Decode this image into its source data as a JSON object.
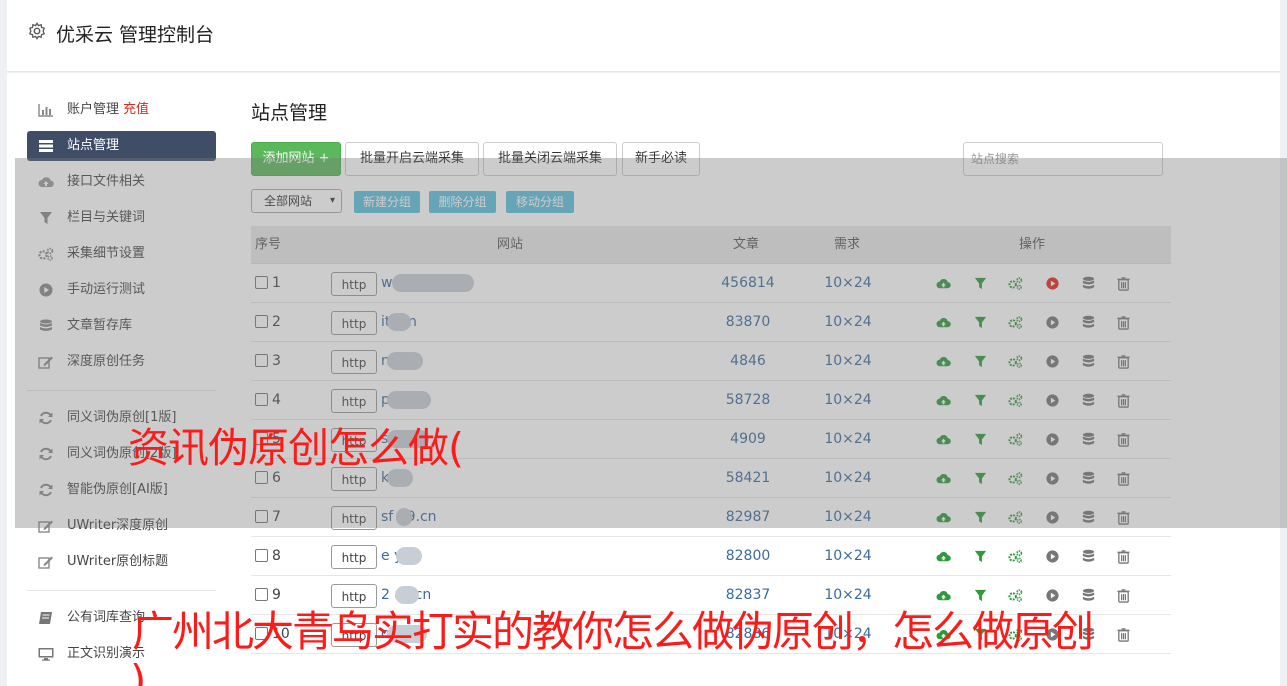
{
  "header": {
    "title": "优采云 管理控制台",
    "icon": "gear-icon"
  },
  "sidebar": {
    "items": [
      {
        "label": "账户管理",
        "extra": "充值",
        "icon": "bar-chart-icon"
      },
      {
        "label": "站点管理",
        "icon": "server-icon",
        "active": true
      },
      {
        "label": "接口文件相关",
        "icon": "cloud-upload-icon"
      },
      {
        "label": "栏目与关键词",
        "icon": "filter-icon"
      },
      {
        "label": "采集细节设置",
        "icon": "gears-icon"
      },
      {
        "label": "手动运行测试",
        "icon": "play-circle-icon"
      },
      {
        "label": "文章暂存库",
        "icon": "database-icon"
      },
      {
        "label": "深度原创任务",
        "icon": "edit-icon"
      },
      {
        "label": "同义词伪原创[1版]",
        "icon": "refresh-icon"
      },
      {
        "label": "同义词伪原创[2版]",
        "icon": "refresh-icon"
      },
      {
        "label": "智能伪原创[AI版]",
        "icon": "refresh-icon"
      },
      {
        "label": "UWriter深度原创",
        "icon": "edit-icon"
      },
      {
        "label": "UWriter原创标题",
        "icon": "edit-icon"
      },
      {
        "label": "公有词库查询",
        "icon": "book-icon"
      },
      {
        "label": "正文识别演示",
        "icon": "desktop-icon"
      }
    ]
  },
  "main": {
    "title": "站点管理",
    "buttons": {
      "add_site": "添加网站 +",
      "batch_open": "批量开启云端采集",
      "batch_close": "批量关闭云端采集",
      "newbie": "新手必读"
    },
    "search_placeholder": "站点搜索",
    "filter": {
      "selected": "全部网站",
      "new_group": "新建分组",
      "delete_group": "删除分组",
      "move_group": "移动分组"
    },
    "table": {
      "headers": {
        "index": "序号",
        "site": "网站",
        "articles": "文章",
        "demand": "需求",
        "actions": "操作"
      },
      "rows": [
        {
          "index": "1",
          "protocol": "http",
          "site": "w          .com",
          "articles": "456814",
          "demand": "10×24"
        },
        {
          "index": "2",
          "protocol": "http",
          "site": "       itt.cn",
          "articles": "83870",
          "demand": "10×24"
        },
        {
          "index": "3",
          "protocol": "http",
          "site": "        ni.cn",
          "articles": "4846",
          "demand": "10×24"
        },
        {
          "index": "4",
          "protocol": "http",
          "site": "        pay.cn",
          "articles": "58728",
          "demand": "10×24"
        },
        {
          "index": "5",
          "protocol": "http",
          "site": "        s.cn",
          "articles": "4909",
          "demand": "10×24"
        },
        {
          "index": "6",
          "protocol": "http",
          "site": "       k.cn",
          "articles": "58421",
          "demand": "10×24"
        },
        {
          "index": "7",
          "protocol": "http",
          "site": "sf  39.cn",
          "articles": "82987",
          "demand": "10×24"
        },
        {
          "index": "8",
          "protocol": "http",
          "site": "e      y.cn",
          "articles": "82800",
          "demand": "10×24"
        },
        {
          "index": "9",
          "protocol": "http",
          "site": "2      az.cn",
          "articles": "82837",
          "demand": "10×24"
        },
        {
          "index": "10",
          "protocol": "http",
          "site": "        cn",
          "articles": "82886",
          "demand": "10×24"
        }
      ]
    }
  },
  "captions": {
    "line1": "资讯伪原创怎么做(",
    "line2": "广州北大青鸟实打实的教你怎么做伪原创，怎么做原创",
    "line3": ")"
  },
  "colors": {
    "accent_green": "#5cb85c",
    "active_nav": "#3f4e66",
    "link_blue": "#3a6aa0",
    "caption_red": "#ff1a1a",
    "run_red": "#e0261b"
  }
}
